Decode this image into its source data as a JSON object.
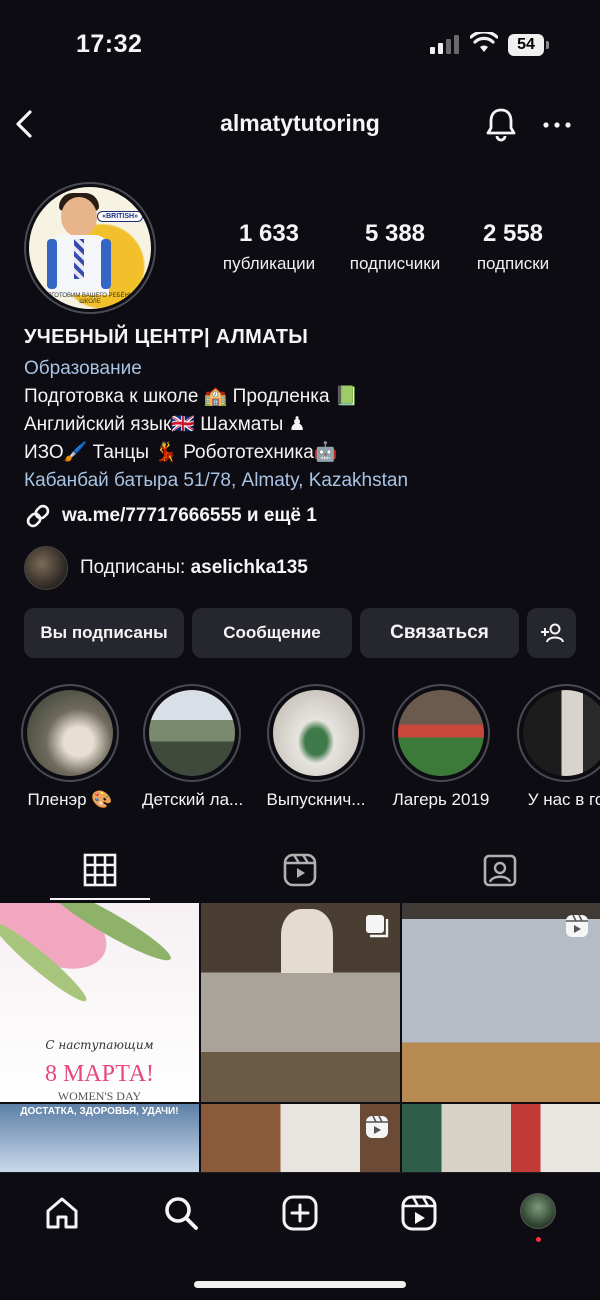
{
  "status_bar": {
    "time": "17:32",
    "battery": "54"
  },
  "header": {
    "username": "almatytutoring"
  },
  "profile": {
    "avatar_badge": "«BRITISH»",
    "avatar_caption": "ПОДГОТОВИМ ВАШЕГО РЕБЁНКА К ШКОЛЕ",
    "stats": [
      {
        "value": "1 633",
        "label": "публикации"
      },
      {
        "value": "5 388",
        "label": "подписчики"
      },
      {
        "value": "2 558",
        "label": "подписки"
      }
    ],
    "name": "УЧЕБНЫЙ ЦЕНТР| АЛМАТЫ",
    "category": "Образование",
    "bio_lines": [
      "Подготовка к школе 🏫 Продленка 📗",
      "Английский язык🇬🇧 Шахматы ♟",
      "ИЗО🖌️ Танцы 💃 Робототехника🤖"
    ],
    "address": "Кабанбай батыра 51/78, Almaty, Kazakhstan",
    "link": "wa.me/77717666555 и ещё 1",
    "followed_by_label": "Подписаны: ",
    "followed_by_user": "aselichka135"
  },
  "actions": {
    "following": "Вы подписаны",
    "message": "Сообщение",
    "contact": "Связаться"
  },
  "highlights": [
    {
      "label": "Пленэр 🎨"
    },
    {
      "label": "Детский ла..."
    },
    {
      "label": "Выпускнич..."
    },
    {
      "label": "Лагерь 2019"
    },
    {
      "label": "У нас в го"
    }
  ],
  "posts": {
    "p1_line1": "С наступающим",
    "p1_line2": "8 МАРТА!",
    "p1_line3": "WOMEN'S DAY",
    "p4_text": "ДОСТАТКА, ЗДОРОВЬЯ, УДАЧИ!"
  },
  "colors": {
    "background": "#0c0c12",
    "button": "#26262e",
    "link_blue": "#a9c3e4",
    "notify_dot": "#ff3040"
  }
}
